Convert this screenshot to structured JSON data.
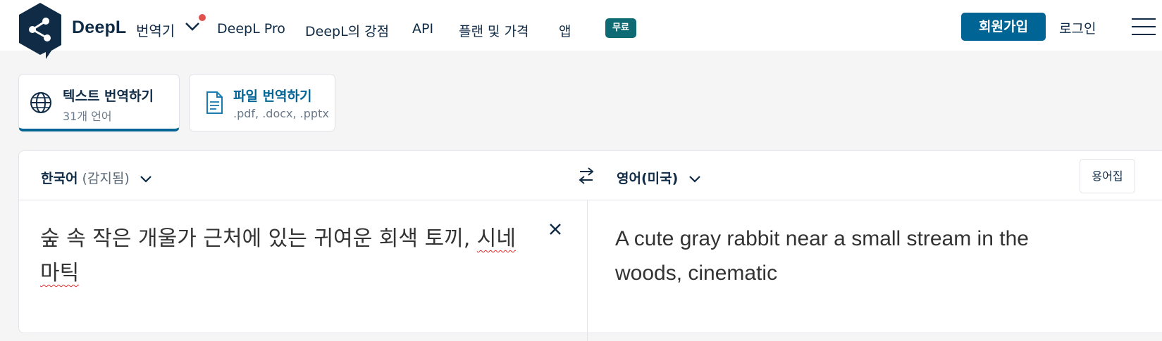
{
  "header": {
    "brand": "DeepL",
    "brand_sub": "번역기",
    "nav": [
      {
        "label": "DeepL Pro"
      },
      {
        "label": "DeepL의 강점"
      },
      {
        "label": "API"
      },
      {
        "label": "플랜 및 가격"
      },
      {
        "label": "앱"
      }
    ],
    "apps_badge": "무료",
    "signup": "회원가입",
    "login": "로그인",
    "colors": {
      "primary": "#006494",
      "badge": "#0f6b73",
      "notification": "#e0524e",
      "text": "#0f2b46"
    }
  },
  "modes": [
    {
      "title": "텍스트 번역하기",
      "subtitle": "31개 언어",
      "icon": "globe-icon",
      "active": true
    },
    {
      "title": "파일 번역하기",
      "subtitle": ".pdf, .docx, .pptx",
      "icon": "document-icon",
      "active": false
    }
  ],
  "translator": {
    "source_lang": "한국어",
    "source_detected": "(감지됨)",
    "target_lang": "영어(미국)",
    "glossary": "용어집",
    "source_text_main": "숲 속 작은 개울가 근처에 있는 귀여운 회색 토끼, ",
    "source_text_misspelled": "시네마틱",
    "target_text": "A cute gray rabbit near a small stream in the woods, cinematic"
  }
}
